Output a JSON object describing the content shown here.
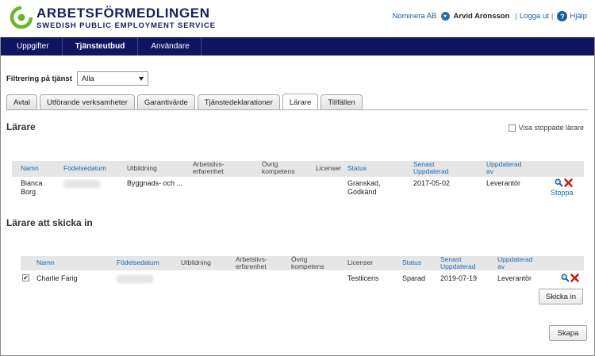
{
  "brand": {
    "title": "ARBETSFÖRMEDLINGEN",
    "subtitle": "SWEDISH PUBLIC EMPLOYMENT SERVICE",
    "color": "#1a1f5c",
    "mark_color": "#6bb42c"
  },
  "user_area": {
    "org": "Nominera AB",
    "user": "Arvid Aronsson",
    "logout": "Logga ut",
    "separator": "|",
    "help": "Hjälp",
    "help_icon": "?"
  },
  "nav": {
    "items": [
      {
        "label": "Uppgifter"
      },
      {
        "label": "Tjänsteutbud"
      },
      {
        "label": "Användare"
      }
    ],
    "background": "#111461"
  },
  "filter": {
    "label": "Filtrering på tjänst",
    "value": "Alla"
  },
  "tabs": [
    {
      "label": "Avtal"
    },
    {
      "label": "Utförande verksamheter"
    },
    {
      "label": "Garantivärde"
    },
    {
      "label": "Tjänstedeklarationer"
    },
    {
      "label": "Lärare"
    },
    {
      "label": "Tillfällen"
    }
  ],
  "teachers": {
    "title": "Lärare",
    "show_stopped_label": "Visa stoppade lärare",
    "columns": {
      "name": "Namn",
      "birthdate": "Födelsedatum",
      "education": "Utbildning",
      "work_exp_1": "Arbetslivs-",
      "work_exp_2": "erfarenhet",
      "other_1": "Övrig",
      "other_2": "kompetens",
      "licenses": "Licenser",
      "status": "Status",
      "updated_1": "Senast",
      "updated_2": "Uppdaterad",
      "updated_by_1": "Uppdaterad",
      "updated_by_2": "av"
    },
    "rows": [
      {
        "name_1": "Bianca",
        "name_2": "Borg",
        "education": "Byggnads- och ...",
        "status_1": "Granskad,",
        "status_2": "Godkänd",
        "updated": "2017-05-02",
        "updated_by": "Leverantör",
        "stop": "Stoppa"
      }
    ]
  },
  "to_send": {
    "title": "Lärare att skicka in",
    "columns": {
      "name": "Namn",
      "birthdate": "Födelsedatum",
      "education": "Utbildning",
      "work_exp_1": "Arbetslivs-",
      "work_exp_2": "erfarenhet",
      "other_1": "Övrig",
      "other_2": "kompetens",
      "licenses": "Licenser",
      "status": "Status",
      "updated_1": "Senast",
      "updated_2": "Uppdaterad",
      "updated_by_1": "Uppdaterad",
      "updated_by_2": "av"
    },
    "rows": [
      {
        "checked": true,
        "name": "Charlie Farig",
        "licenses": "Testlicens",
        "status": "Sparad",
        "updated": "2019-07-19",
        "updated_by": "Leverantör"
      }
    ],
    "send_button": "Skicka in"
  },
  "create_button": "Skapa"
}
